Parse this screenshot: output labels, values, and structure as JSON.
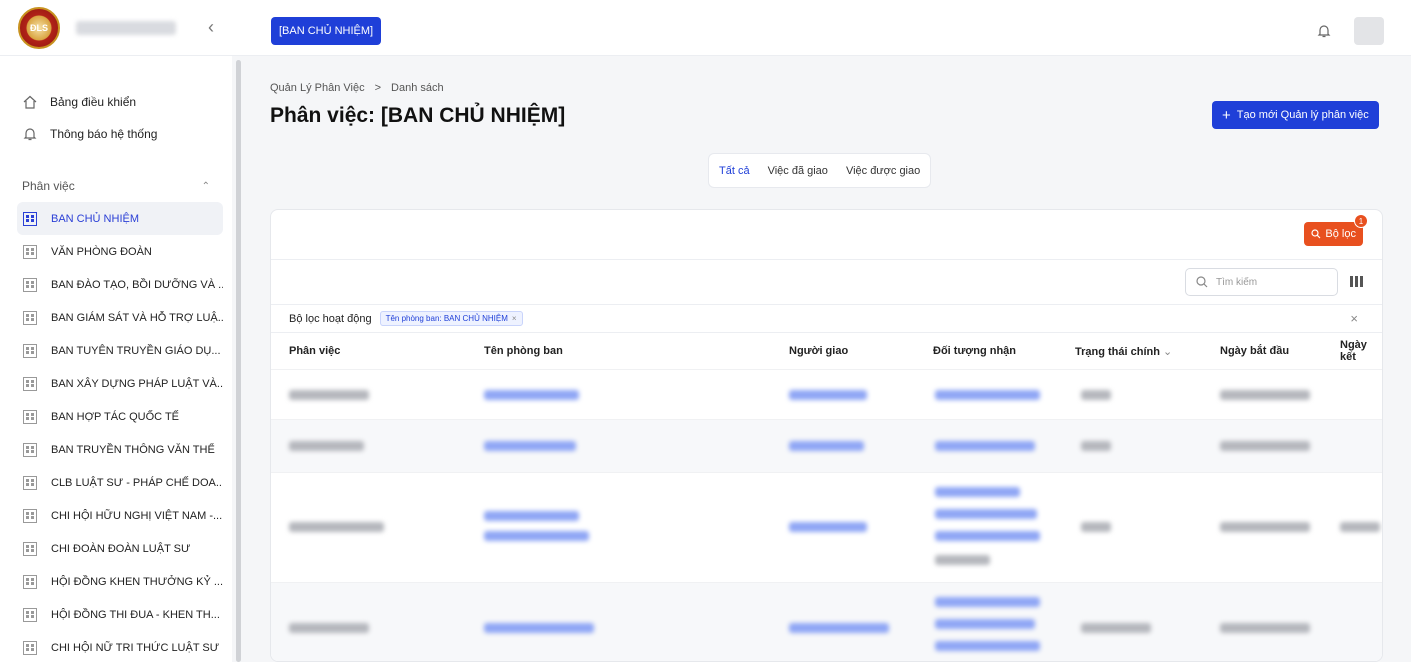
{
  "sidebar": {
    "top_items": [
      "Bảng điều khiển",
      "Thông báo hệ thống"
    ],
    "section_title": "Phân việc",
    "departments": [
      "BAN CHỦ NHIỆM",
      "VĂN PHÒNG ĐOÀN",
      "BAN ĐÀO TẠO, BỒI DƯỠNG VÀ ...",
      "BAN GIÁM SÁT VÀ HỖ TRỢ LUẬ...",
      "BAN TUYÊN TRUYỀN GIÁO DỤ...",
      "BAN XÂY DỰNG PHÁP LUẬT VÀ...",
      "BAN HỢP TÁC QUỐC TẾ",
      "BAN TRUYỀN THÔNG VĂN THỂ",
      "CLB LUẬT SƯ - PHÁP CHẾ DOA...",
      "CHI HỘI HỮU NGHỊ VIỆT NAM -...",
      "CHI ĐOÀN ĐOÀN LUẬT SƯ",
      "HỘI ĐỒNG KHEN THƯỞNG KỶ ...",
      "HỘI ĐỒNG THI ĐUA - KHEN TH...",
      "CHI HỘI NỮ TRI THỨC LUẬT SƯ"
    ]
  },
  "topbar": {
    "tag": "[BAN CHỦ NHIỆM]"
  },
  "breadcrumb": [
    "Quản Lý Phân Việc",
    ">",
    "Danh sách"
  ],
  "page_title": "Phân việc: [BAN CHỦ NHIỆM]",
  "create_button": "Tạo mới Quản lý phân việc",
  "tabs": [
    "Tất cả",
    "Việc đã giao",
    "Việc được giao"
  ],
  "filter_button": "Bộ lọc",
  "filter_badge": "1",
  "search_placeholder": "Tìm kiếm",
  "active_filters_label": "Bộ lọc hoạt động",
  "active_filter_chip": "Tên phòng ban: BAN CHỦ NHIỆM",
  "columns": [
    "Phân việc",
    "Tên phòng ban",
    "Người giao",
    "Đối tượng nhận",
    "Trạng thái chính",
    "Ngày bắt đầu",
    "Ngày kết"
  ],
  "colors": {
    "primary": "#1f3fd8",
    "filter": "#e8501f"
  }
}
